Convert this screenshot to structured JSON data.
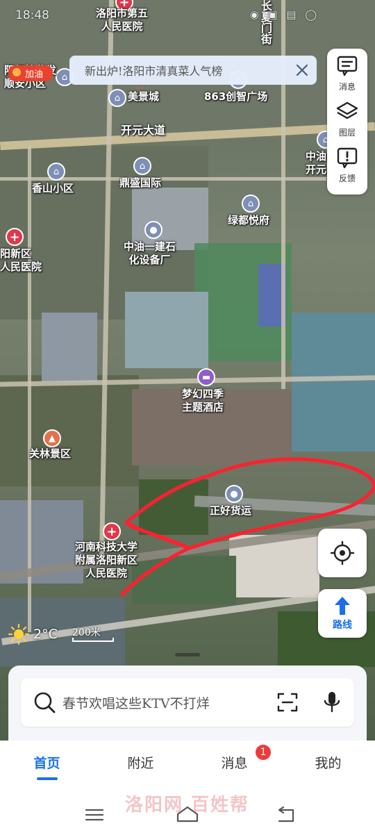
{
  "status_bar": {
    "time": "18:48",
    "icons": "◉ ▣ ▤ ◯"
  },
  "banner": {
    "text": "新出炉!洛阳市清真菜人气榜"
  },
  "fuel_badge": {
    "label": "加油"
  },
  "map": {
    "roads": [
      {
        "label": "开元大道"
      },
      {
        "label": "长夏门街"
      }
    ],
    "pois": [
      {
        "name": "洛阳市第五\n人民医院",
        "type": "hospital"
      },
      {
        "name": "美景城",
        "type": "place"
      },
      {
        "name": "863创智广场",
        "type": "place"
      },
      {
        "name": "阳纪检监发\n顺安小区",
        "type": "place"
      },
      {
        "name": "中油\n开元",
        "type": "place"
      },
      {
        "name": "香山小区",
        "type": "place"
      },
      {
        "name": "鼎盛国际",
        "type": "place"
      },
      {
        "name": "绿都悦府",
        "type": "place"
      },
      {
        "name": "中油一建石\n化设备厂",
        "type": "place"
      },
      {
        "name": "阳新区\n人民医院",
        "type": "hospital"
      },
      {
        "name": "梦幻四季\n主题酒店",
        "type": "hotel"
      },
      {
        "name": "关林景区",
        "type": "scenic"
      },
      {
        "name": "正好货运",
        "type": "place"
      },
      {
        "name": "河南科技大学\n附属洛阳新区\n人民医院",
        "type": "hospital"
      }
    ]
  },
  "right_tools": [
    {
      "label": "消息",
      "icon": "message-icon"
    },
    {
      "label": "图层",
      "icon": "layers-icon"
    },
    {
      "label": "反馈",
      "icon": "feedback-icon"
    }
  ],
  "route_button": {
    "label": "路线"
  },
  "weather": {
    "temp": "2°C"
  },
  "scale": {
    "label": "200米"
  },
  "search": {
    "placeholder": "春节欢唱这些KTV不打烊"
  },
  "bottom_nav": [
    {
      "label": "首页",
      "active": true
    },
    {
      "label": "附近",
      "active": false
    },
    {
      "label": "消息",
      "active": false,
      "badge": "1"
    },
    {
      "label": "我的",
      "active": false
    }
  ],
  "watermark": {
    "text": "洛阳网 百姓帮"
  },
  "colors": {
    "accent": "#1a6fe8",
    "badge": "#f03a3a",
    "annotation": "#ff2030"
  }
}
